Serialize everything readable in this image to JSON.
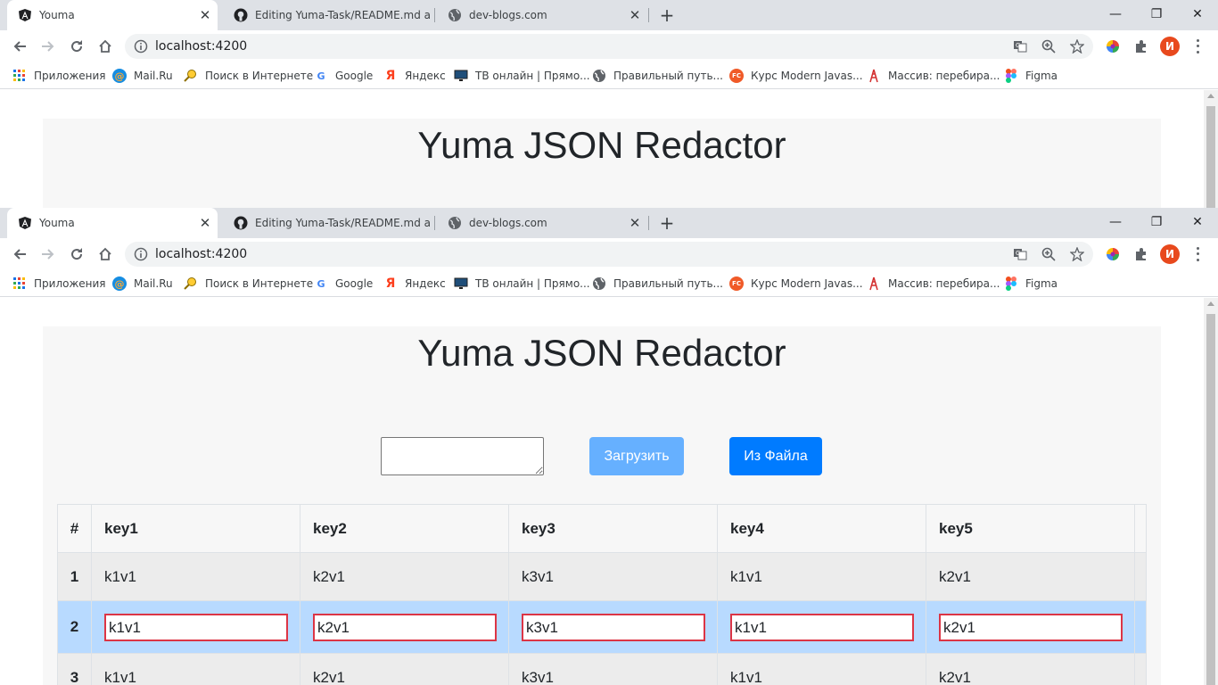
{
  "browser": {
    "tabs": [
      {
        "title": "Youma",
        "icon": "angular-icon",
        "active": true
      },
      {
        "title": "Editing Yuma-Task/README.md a",
        "icon": "github-icon",
        "active": false
      },
      {
        "title": "dev-blogs.com",
        "icon": "globe-icon",
        "active": false
      }
    ],
    "new_tab": "+",
    "url": "localhost:4200",
    "profile_initial": "И",
    "bookmarks": [
      {
        "label": "Приложения",
        "icon": "apps-grid-icon"
      },
      {
        "label": "Mail.Ru",
        "icon": "mailru-icon"
      },
      {
        "label": "Поиск в Интернете",
        "icon": "search-magnifier-icon"
      },
      {
        "label": "Google",
        "icon": "google-icon"
      },
      {
        "label": "Яндекс",
        "icon": "yandex-icon"
      },
      {
        "label": "ТВ онлайн | Прямо...",
        "icon": "tv-icon"
      },
      {
        "label": "Правильный путь...",
        "icon": "globe-icon"
      },
      {
        "label": "Курс Modern Javas...",
        "icon": "fc-icon"
      },
      {
        "label": "Массив: перебира...",
        "icon": "tower-icon"
      },
      {
        "label": "Figma",
        "icon": "figma-icon"
      }
    ]
  },
  "page": {
    "title": "Yuma JSON Redactor",
    "load_button": "Загрузить",
    "file_button": "Из Файла",
    "json_input_value": ""
  },
  "table": {
    "headers": [
      "#",
      "key1",
      "key2",
      "key3",
      "key4",
      "key5"
    ],
    "rows": [
      {
        "num": "1",
        "cells": [
          "k1v1",
          "k2v1",
          "k3v1",
          "k1v1",
          "k2v1"
        ],
        "editing": false
      },
      {
        "num": "2",
        "cells": [
          "k1v1",
          "k2v1",
          "k3v1",
          "k1v1",
          "k2v1"
        ],
        "editing": true
      },
      {
        "num": "3",
        "cells": [
          "k1v1",
          "k2v1",
          "k3v1",
          "k1v1",
          "k2v1"
        ],
        "editing": false
      }
    ]
  },
  "colors": {
    "primary": "#007bff",
    "primary_disabled": "#66b0ff",
    "row_selected": "#b8daff",
    "input_error_border": "#dc3545"
  }
}
